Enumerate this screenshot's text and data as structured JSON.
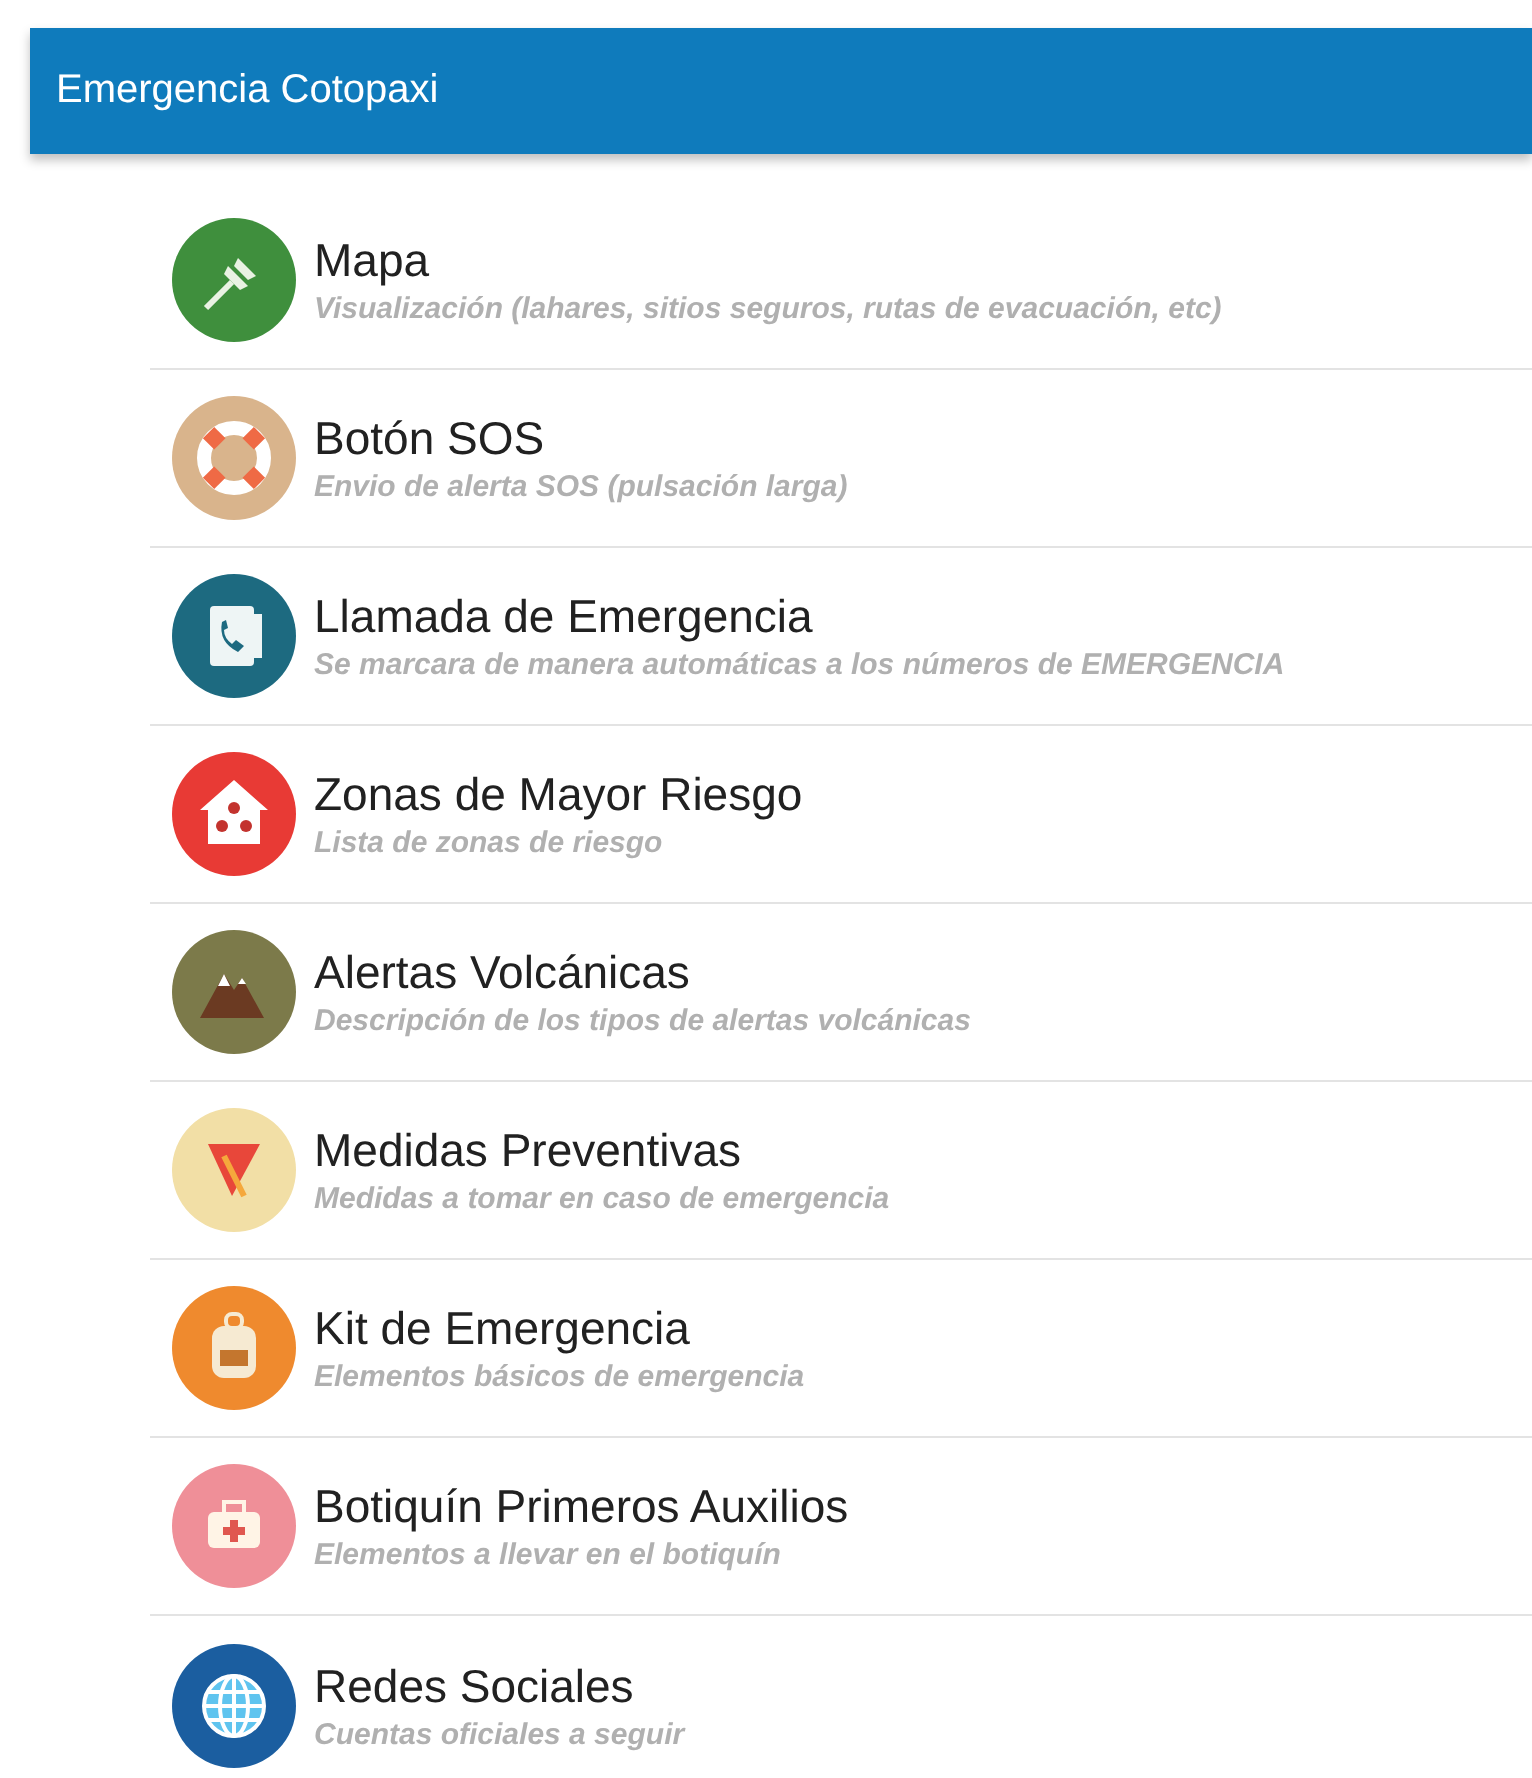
{
  "app_bar": {
    "title": "Emergencia Cotopaxi"
  },
  "menu": [
    {
      "kind": "map",
      "title": "Mapa",
      "subtitle": "Visualización (lahares, sitios seguros, rutas de evacuación, etc)"
    },
    {
      "kind": "sos",
      "title": "Botón SOS",
      "subtitle": "Envio de alerta SOS (pulsación larga)"
    },
    {
      "kind": "call",
      "title": "Llamada de Emergencia",
      "subtitle": "Se marcara de manera automáticas a los números de EMERGENCIA"
    },
    {
      "kind": "zones",
      "title": "Zonas de Mayor Riesgo",
      "subtitle": "Lista de zonas de riesgo"
    },
    {
      "kind": "volcano",
      "title": "Alertas Volcánicas",
      "subtitle": "Descripción de los tipos de alertas volcánicas"
    },
    {
      "kind": "prevent",
      "title": "Medidas Preventivas",
      "subtitle": "Medidas a tomar en caso de emergencia"
    },
    {
      "kind": "kit",
      "title": "Kit de Emergencia",
      "subtitle": "Elementos básicos de emergencia"
    },
    {
      "kind": "firstaid",
      "title": "Botiquín Primeros Auxilios",
      "subtitle": "Elementos a llevar en el botiquín"
    },
    {
      "kind": "social",
      "title": "Redes Sociales",
      "subtitle": "Cuentas oficiales a seguir"
    }
  ]
}
